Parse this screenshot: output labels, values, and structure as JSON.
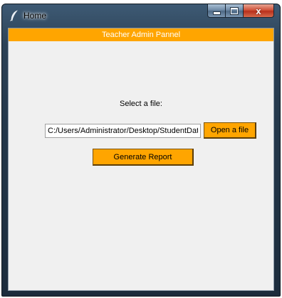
{
  "window": {
    "title": "Home",
    "icon": "feather-icon",
    "controls": [
      "minimize-icon",
      "maximize-icon",
      "close-icon"
    ],
    "close_glyph": "x"
  },
  "header": {
    "text": "Teacher Admin Pannel",
    "color": "#ffa500",
    "text_color": "#ffffff"
  },
  "file_picker": {
    "label": "Select a file:",
    "path_value": "C:/Users/Administrator/Desktop/StudentData",
    "open_button_label": "Open a file"
  },
  "actions": {
    "generate_button_label": "Generate Report",
    "button_color": "#ffa500"
  }
}
